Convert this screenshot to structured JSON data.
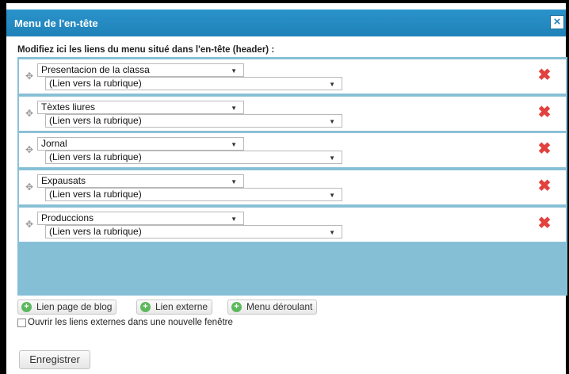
{
  "dialog": {
    "title": "Menu de l'en-tête",
    "close_label": "×",
    "instructions": "Modifiez ici les liens du menu situé dans l'en-tête (header) :"
  },
  "menu": {
    "items": [
      {
        "title": "Presentacion de la classa",
        "link": "(Lien vers la rubrique)"
      },
      {
        "title": "Tèxtes liures",
        "link": "(Lien vers la rubrique)"
      },
      {
        "title": "Jornal",
        "link": "(Lien vers la rubrique)"
      },
      {
        "title": "Expausats",
        "link": "(Lien vers la rubrique)"
      },
      {
        "title": "Produccions",
        "link": "(Lien vers la rubrique)"
      }
    ]
  },
  "actions": {
    "add_blog_page": "Lien page de blog",
    "add_external": "Lien externe",
    "add_dropdown": "Menu déroulant",
    "new_window_label": "Ouvrir les liens externes dans une nouvelle fenêtre",
    "save": "Enregistrer"
  },
  "icons": {
    "drag": "move-handle-icon",
    "delete": "delete-x-icon",
    "add": "plus-circle-icon",
    "close": "close-icon"
  },
  "colors": {
    "titlebar": "#1f82b8",
    "menu_area": "#84bfd6",
    "delete": "#e2413e",
    "add": "#5cb85c"
  }
}
